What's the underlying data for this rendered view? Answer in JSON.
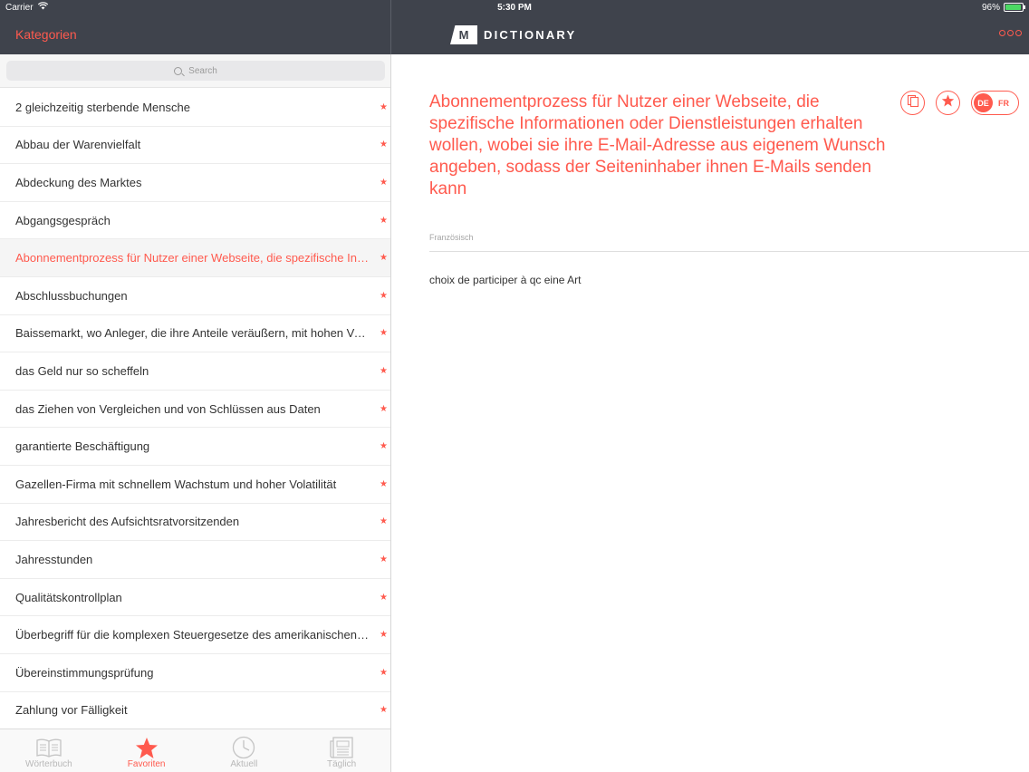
{
  "status_bar": {
    "carrier": "Carrier",
    "time": "5:30 PM",
    "battery": "96%",
    "battery_level": 0.96,
    "battery_color": "#4cd964"
  },
  "nav": {
    "left_title": "Kategorien",
    "logo_letter": "M",
    "logo_word": "DICTIONARY",
    "more_icon": "ellipsis-icon"
  },
  "colors": {
    "accent": "#ff5a4e",
    "nav_background": "#3f434c"
  },
  "search": {
    "placeholder": "Search",
    "icon": "search-icon"
  },
  "list": {
    "items": [
      {
        "label": "2 gleichzeitig sterbende Mensche"
      },
      {
        "label": "Abbau der Warenvielfalt"
      },
      {
        "label": "Abdeckung des Marktes"
      },
      {
        "label": "Abgangsgespräch"
      },
      {
        "label": "Abonnementprozess für Nutzer einer Webseite, die spezifische Informationen oder Dienstleistungen erhalten wollen",
        "selected": true
      },
      {
        "label": "Abschlussbuchungen"
      },
      {
        "label": "Baissemarkt, wo Anleger, die ihre Anteile veräußern, mit hohen Verlusten rechnen"
      },
      {
        "label": "das Geld nur so scheffeln"
      },
      {
        "label": "das Ziehen von Vergleichen und von Schlüssen aus Daten"
      },
      {
        "label": "garantierte Beschäftigung"
      },
      {
        "label": "Gazellen-Firma mit schnellem Wachstum und hoher Volatilität"
      },
      {
        "label": "Jahresbericht des Aufsichtsratvorsitzenden"
      },
      {
        "label": "Jahresstunden"
      },
      {
        "label": "Qualitätskontrollplan"
      },
      {
        "label": "Überbegriff für die komplexen Steuergesetze des amerikanischen Staates"
      },
      {
        "label": "Übereinstimmungsprüfung"
      },
      {
        "label": "Zahlung vor Fälligkeit"
      }
    ],
    "star_glyph": "★"
  },
  "tabs": [
    {
      "label": "Wörterbuch",
      "icon": "book-icon"
    },
    {
      "label": "Favoriten",
      "icon": "star-icon",
      "active": true
    },
    {
      "label": "Aktuell",
      "icon": "clock-icon"
    },
    {
      "label": "Täglich",
      "icon": "newspaper-icon"
    }
  ],
  "detail": {
    "term": "Abonnementprozess für Nutzer einer Webseite, die spezifische Informationen oder Dienstleistungen erhalten wollen, wobei sie ihre E-Mail-Adresse aus eigenem Wunsch angeben, sodass der Seiteninhaber ihnen E-Mails senden kann",
    "copy_icon": "copy-icon",
    "favorite_icon": "star-icon",
    "lang_from": "DE",
    "lang_to": "FR",
    "section_label": "Französisch",
    "translation": "choix de participer à qc eine Art"
  }
}
